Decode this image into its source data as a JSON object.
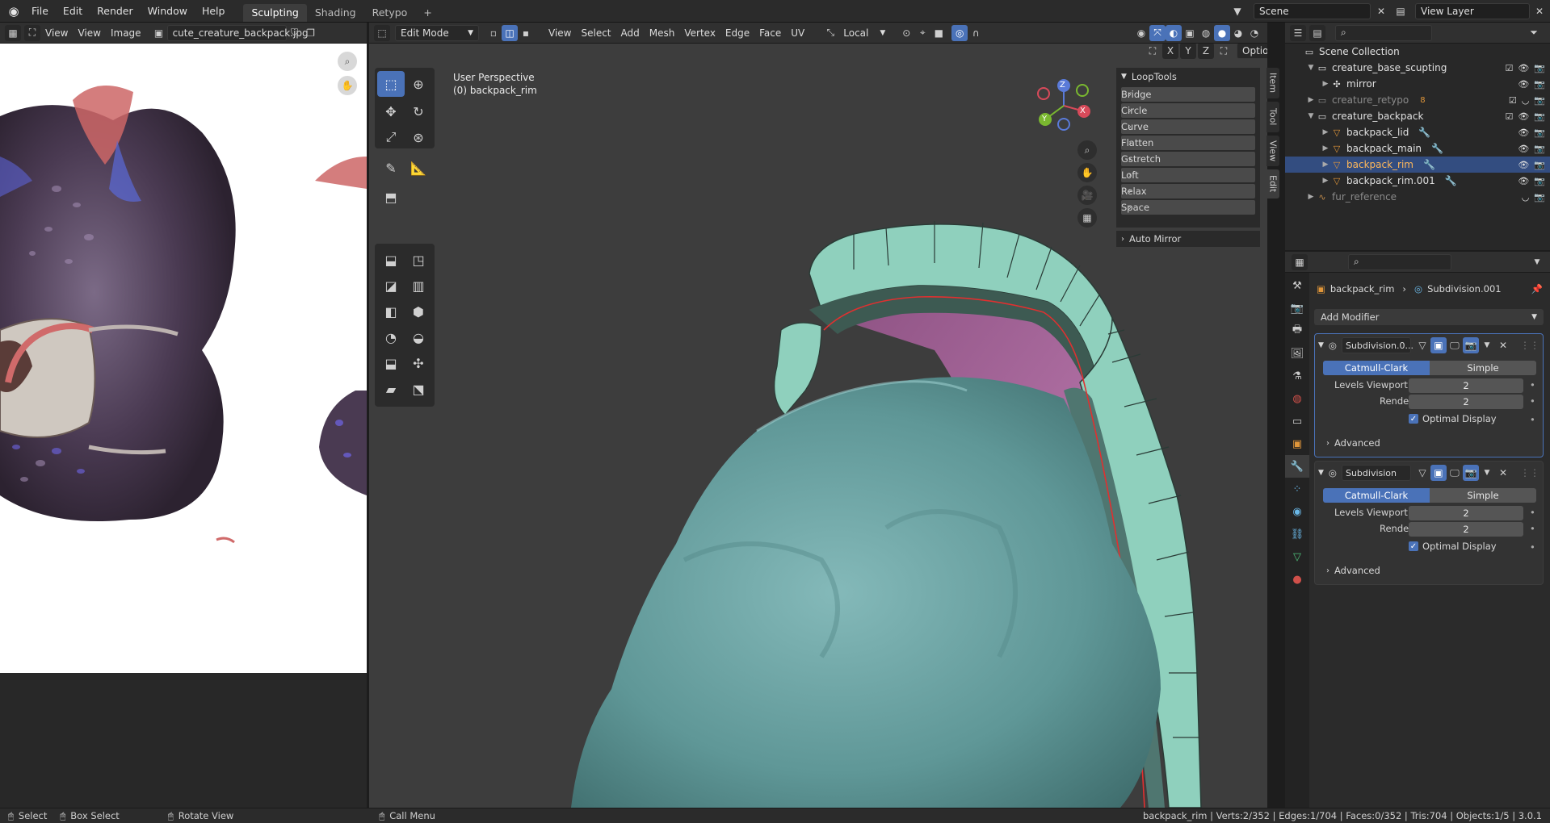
{
  "topbar": {
    "menus": [
      "File",
      "Edit",
      "Render",
      "Window",
      "Help"
    ],
    "workspaces": [
      "Sculpting",
      "Shading",
      "Retypo"
    ],
    "active_workspace": "Sculpting",
    "add_workspace": "+",
    "scene": "Scene",
    "view_layer": "View Layer"
  },
  "image_editor": {
    "menus": [
      "View",
      "View",
      "Image"
    ],
    "image_name": "cute_creature_backpack.jpg"
  },
  "viewport": {
    "mode": "Edit Mode",
    "menus": [
      "View",
      "Select",
      "Add",
      "Mesh",
      "Vertex",
      "Edge",
      "Face",
      "UV"
    ],
    "transform_orientation": "Local",
    "perspective": "User Perspective",
    "object_label": "(0) backpack_rim",
    "options": "Options",
    "axes": [
      "X",
      "Y",
      "Z"
    ],
    "gizmo": {
      "x": "X",
      "y": "Y",
      "z": "Z"
    }
  },
  "looptools": {
    "title": "LoopTools",
    "buttons": [
      "Bridge",
      "Circle",
      "Curve",
      "Flatten",
      "Gstretch",
      "Loft",
      "Relax",
      "Space"
    ],
    "auto_mirror": "Auto Mirror"
  },
  "side_tabs": [
    "Item",
    "Tool",
    "View",
    "Edit"
  ],
  "outliner": {
    "root": "Scene Collection",
    "rows": [
      {
        "name": "creature_base_scupting",
        "kind": "collection",
        "indent": 1
      },
      {
        "name": "mirror",
        "kind": "object",
        "indent": 2
      },
      {
        "name": "creature_retypo",
        "kind": "collection-dim",
        "indent": 1,
        "badge": "8"
      },
      {
        "name": "creature_backpack",
        "kind": "collection",
        "indent": 1
      },
      {
        "name": "backpack_lid",
        "kind": "mesh",
        "indent": 2
      },
      {
        "name": "backpack_main",
        "kind": "mesh",
        "indent": 2
      },
      {
        "name": "backpack_rim",
        "kind": "mesh",
        "indent": 2,
        "selected": true
      },
      {
        "name": "backpack_rim.001",
        "kind": "mesh",
        "indent": 2
      },
      {
        "name": "fur_reference",
        "kind": "curve-dim",
        "indent": 1
      }
    ]
  },
  "properties": {
    "breadcrumb_object": "backpack_rim",
    "breadcrumb_modifier": "Subdivision.001",
    "add_modifier": "Add Modifier",
    "modifiers": [
      {
        "name": "Subdivision.0...",
        "mode_active": "Catmull-Clark",
        "mode_other": "Simple",
        "levels_label": "Levels Viewport",
        "levels_value": "2",
        "render_label": "Render",
        "render_value": "2",
        "optimal": "Optimal Display",
        "advanced": "Advanced"
      },
      {
        "name": "Subdivision",
        "mode_active": "Catmull-Clark",
        "mode_other": "Simple",
        "levels_label": "Levels Viewport",
        "levels_value": "2",
        "render_label": "Render",
        "render_value": "2",
        "optimal": "Optimal Display",
        "advanced": "Advanced"
      }
    ]
  },
  "statusbar": {
    "select": "Select",
    "box_select": "Box Select",
    "rotate_view": "Rotate View",
    "call_menu": "Call Menu",
    "stats": "backpack_rim | Verts:2/352 | Edges:1/704 | Faces:0/352 | Tris:704 | Objects:1/5 | 3.0.1"
  },
  "colors": {
    "accent": "#4a72b8",
    "mesh_teal": "#8fd0bd",
    "sculpt_teal": "#6fa7a7",
    "pink": "#b57aa8",
    "selected_edge": "#e03030"
  }
}
